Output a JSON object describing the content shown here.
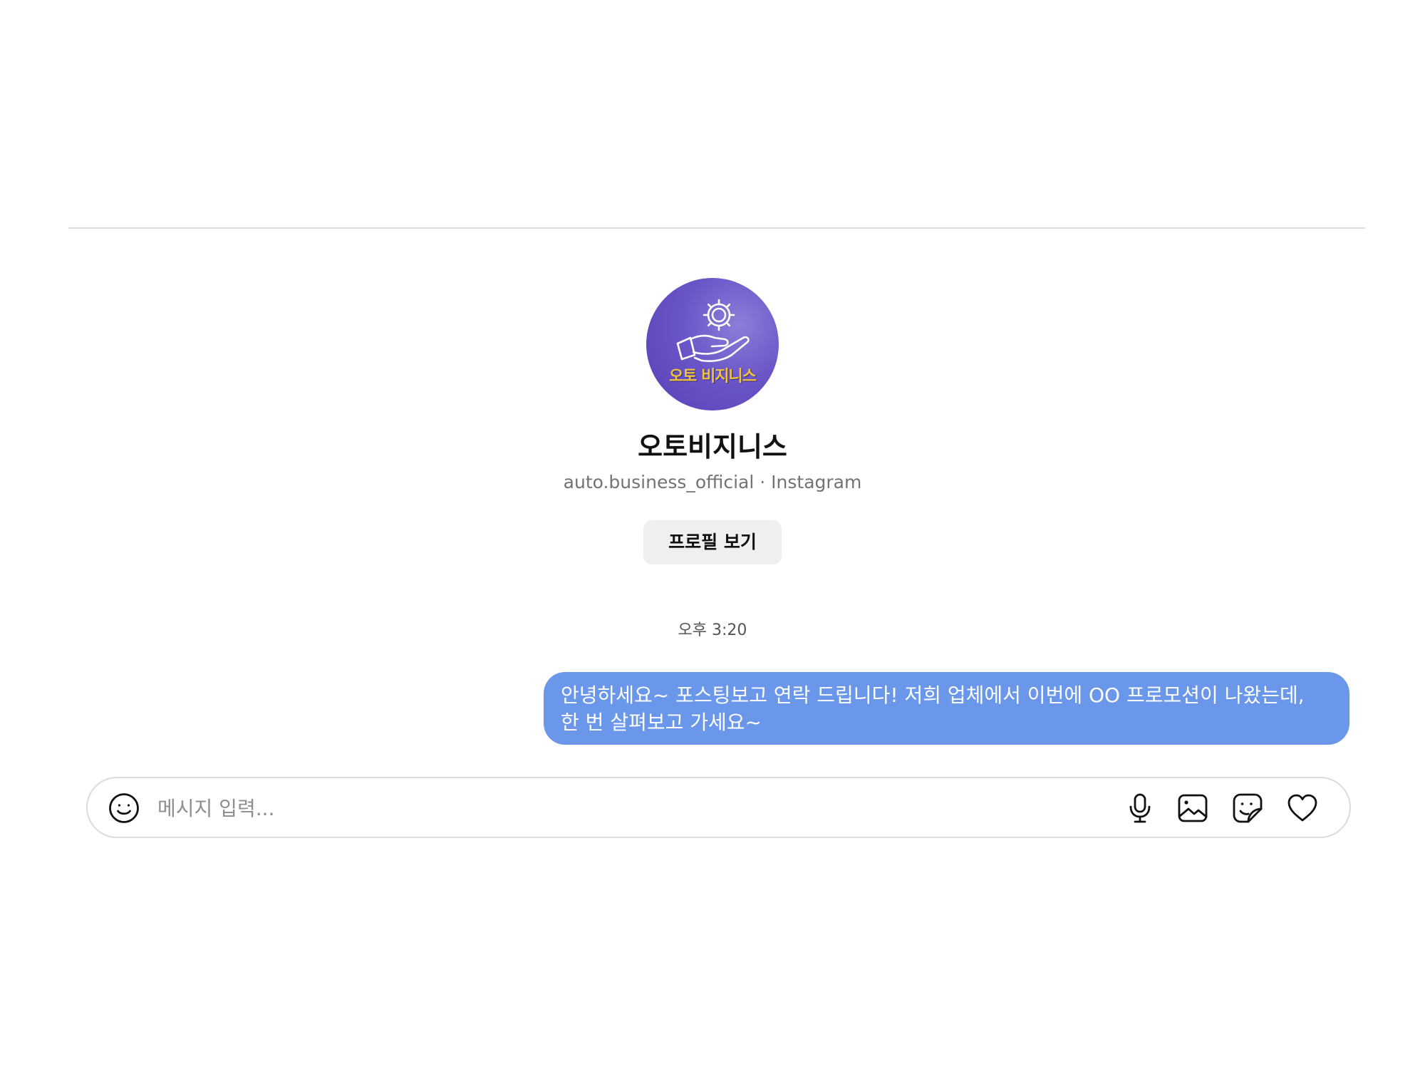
{
  "profile": {
    "name": "오토비지니스",
    "subtitle": "auto.business_official · Instagram",
    "view_profile_label": "프로필 보기",
    "avatar_logo_text": "오토 비지니스",
    "avatar_icon": "hand-with-gear-icon"
  },
  "conversation": {
    "timestamp": "오후 3:20",
    "messages": [
      {
        "sender": "me",
        "text": "안녕하세요~ 포스팅보고 연락 드립니다! 저희 업체에서 이번에 OO 프로모션이 나왔는데,\n한 번 살펴보고 가세요~"
      }
    ]
  },
  "composer": {
    "placeholder": "메시지 입력...",
    "icons": [
      "emoji-icon",
      "microphone-icon",
      "image-icon",
      "sticker-icon",
      "heart-icon"
    ]
  },
  "colors": {
    "bubble": "#6a97ea",
    "avatar": "#6a55c8",
    "avatar_text": "#f0c43a",
    "button_bg": "#efefef",
    "divider": "#dcdcdc"
  }
}
